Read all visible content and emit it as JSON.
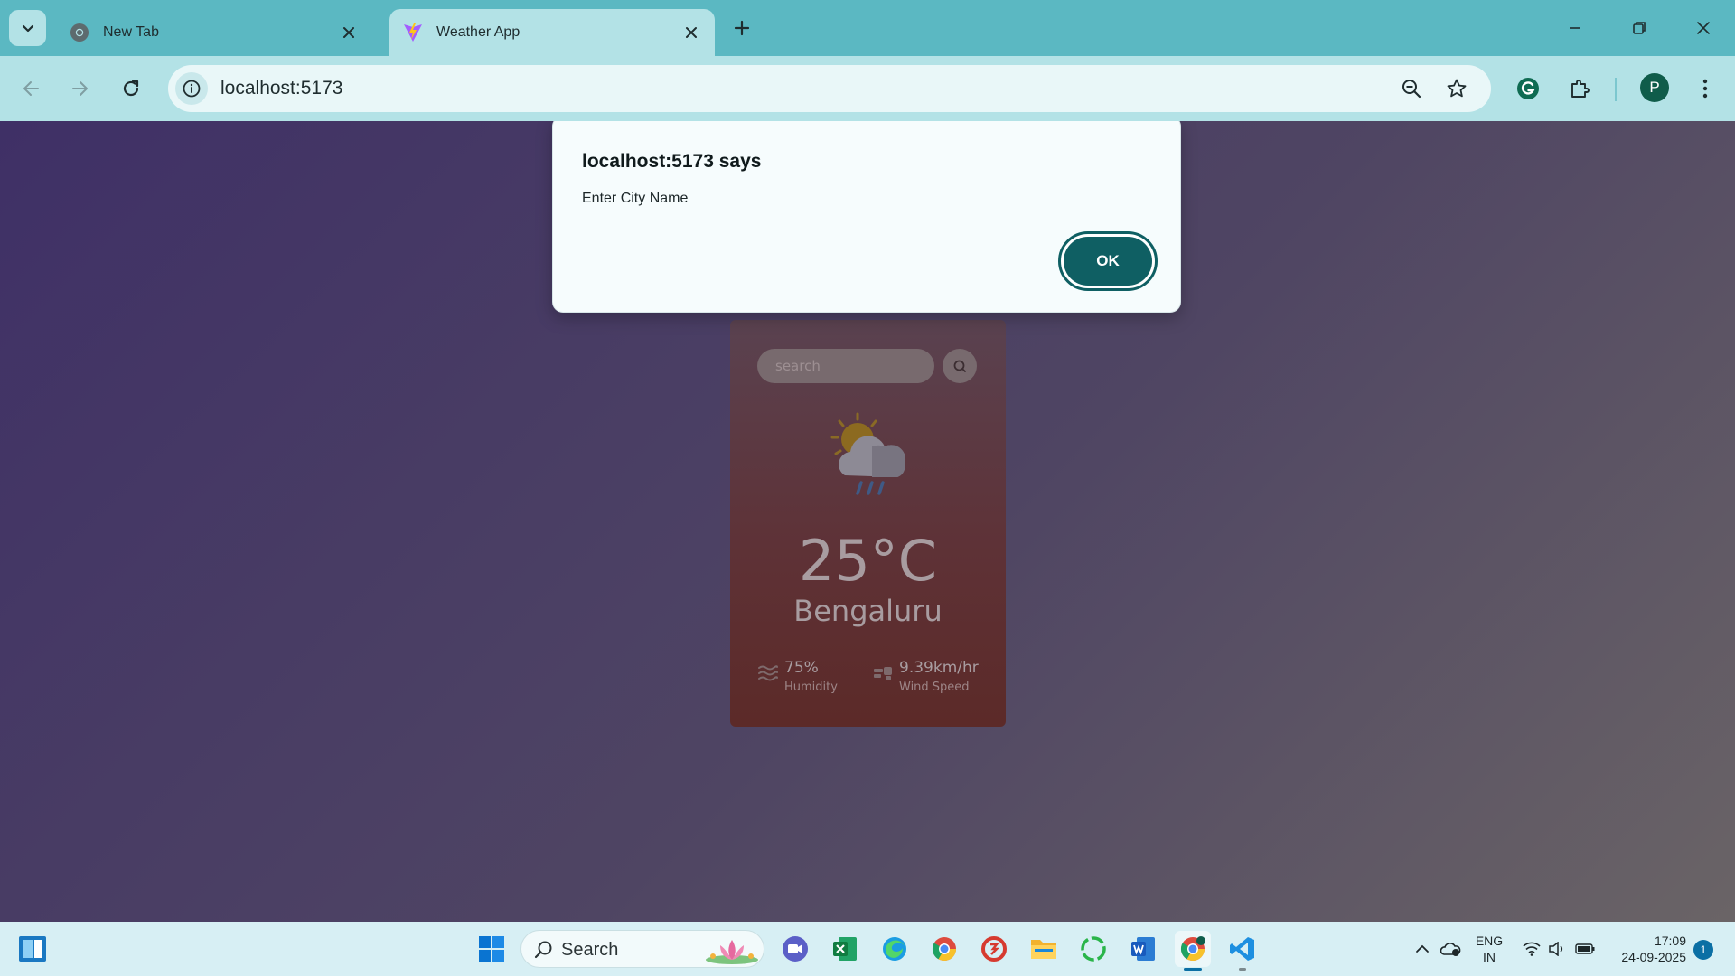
{
  "browser": {
    "tabs": [
      {
        "title": "New Tab",
        "active": false
      },
      {
        "title": "Weather App",
        "active": true
      }
    ],
    "url": "localhost:5173",
    "profile_initial": "P"
  },
  "dialog": {
    "title": "localhost:5173 says",
    "message": "Enter City Name",
    "ok_label": "OK"
  },
  "weather_card": {
    "search_placeholder": "search",
    "temperature": "25°C",
    "city": "Bengaluru",
    "humidity_value": "75%",
    "humidity_label": "Humidity",
    "wind_value": "9.39km/hr",
    "wind_label": "Wind Speed"
  },
  "taskbar": {
    "search_label": "Search",
    "language_line1": "ENG",
    "language_line2": "IN",
    "time": "17:09",
    "date": "24-09-2025",
    "notification_count": "1",
    "apps": [
      "start-icon",
      "search-icon",
      "clipchamp-icon",
      "excel-icon",
      "edge-icon",
      "chrome-icon",
      "app-icon",
      "file-explorer-icon",
      "app-icon",
      "word-icon",
      "chrome-icon",
      "vscode-icon"
    ]
  },
  "colors": {
    "tabstrip": "#5bb8c2",
    "toolbar": "#b3e2e6",
    "dialog_button": "#0f5f63",
    "card_top": "#5a4250",
    "card_bottom": "#5c2a28"
  }
}
